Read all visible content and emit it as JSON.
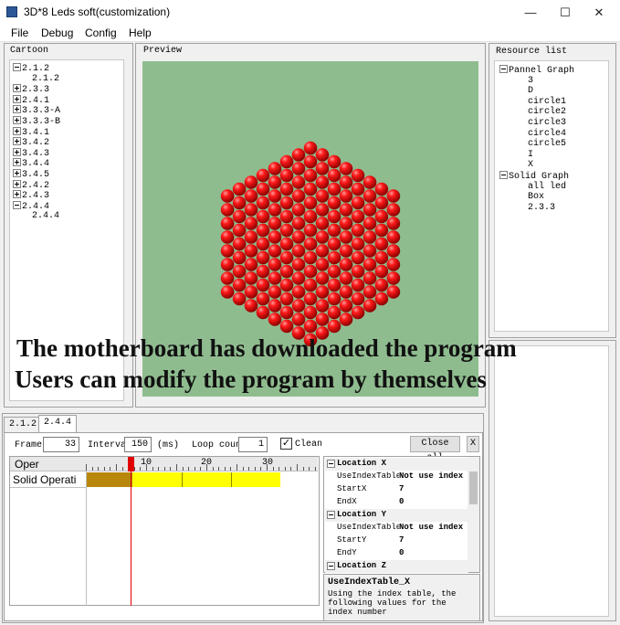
{
  "window": {
    "title": "3D*8 Leds soft(customization)",
    "minimize": "—",
    "maximize": "☐",
    "close": "✕"
  },
  "menu": [
    "File",
    "Debug",
    "Config",
    "Help"
  ],
  "cartoon": {
    "label": "Cartoon",
    "items": [
      {
        "text": "2.1.2",
        "expanded": true
      },
      {
        "text": "2.1.2",
        "child": true
      },
      {
        "text": "2.3.3"
      },
      {
        "text": "2.4.1"
      },
      {
        "text": "3.3.3-A"
      },
      {
        "text": "3.3.3-B"
      },
      {
        "text": "3.4.1"
      },
      {
        "text": "3.4.2"
      },
      {
        "text": "3.4.3"
      },
      {
        "text": "3.4.4"
      },
      {
        "text": "3.4.5"
      },
      {
        "text": "2.4.2"
      },
      {
        "text": "2.4.3"
      },
      {
        "text": "2.4.4",
        "expanded": true
      },
      {
        "text": "2.4.4",
        "child": true
      }
    ]
  },
  "preview": {
    "label": "Preview",
    "bg_color": "#8fbc8f",
    "led_color": "#e00000"
  },
  "overlay": {
    "line1": "The motherboard has downloaded the program",
    "line2": "Users can modify the program by themselves"
  },
  "resource_list": {
    "label": "Resource list",
    "groups": [
      {
        "name": "Pannel Graph",
        "items": [
          "3",
          "D",
          "circle1",
          "circle2",
          "circle3",
          "circle4",
          "circle5",
          "I",
          "X"
        ]
      },
      {
        "name": "Solid Graph",
        "items": [
          "all led",
          "Box",
          "2.3.3"
        ]
      }
    ]
  },
  "tabs": [
    "2.1.2",
    "2.4.4"
  ],
  "controls": {
    "frame_label": "Frame:",
    "frame_value": "33",
    "interval_label": "Interval",
    "interval_value": "150",
    "interval_unit": "(ms)",
    "loop_label": "Loop count",
    "loop_value": "1",
    "clean_label": "Clean",
    "clean_checked": "✓",
    "close_all": "Close all",
    "close_x": "X"
  },
  "timeline": {
    "header": "Oper",
    "row": "Solid Operati",
    "ticks": [
      "10",
      "20",
      "30"
    ],
    "bar_color": "#b8860b",
    "frame_color": "#ffff00"
  },
  "properties": {
    "sections": [
      {
        "name": "Location X",
        "rows": [
          [
            "UseIndexTable",
            "Not use index"
          ],
          [
            "StartX",
            "7"
          ],
          [
            "EndX",
            "0"
          ]
        ]
      },
      {
        "name": "Location Y",
        "rows": [
          [
            "UseIndexTable",
            "Not use index"
          ],
          [
            "StartY",
            "7"
          ],
          [
            "EndY",
            "0"
          ]
        ]
      },
      {
        "name": "Location Z",
        "rows": []
      }
    ],
    "help_title": "UseIndexTable_X",
    "help_text": "Using the index table, the following values for the index number"
  }
}
